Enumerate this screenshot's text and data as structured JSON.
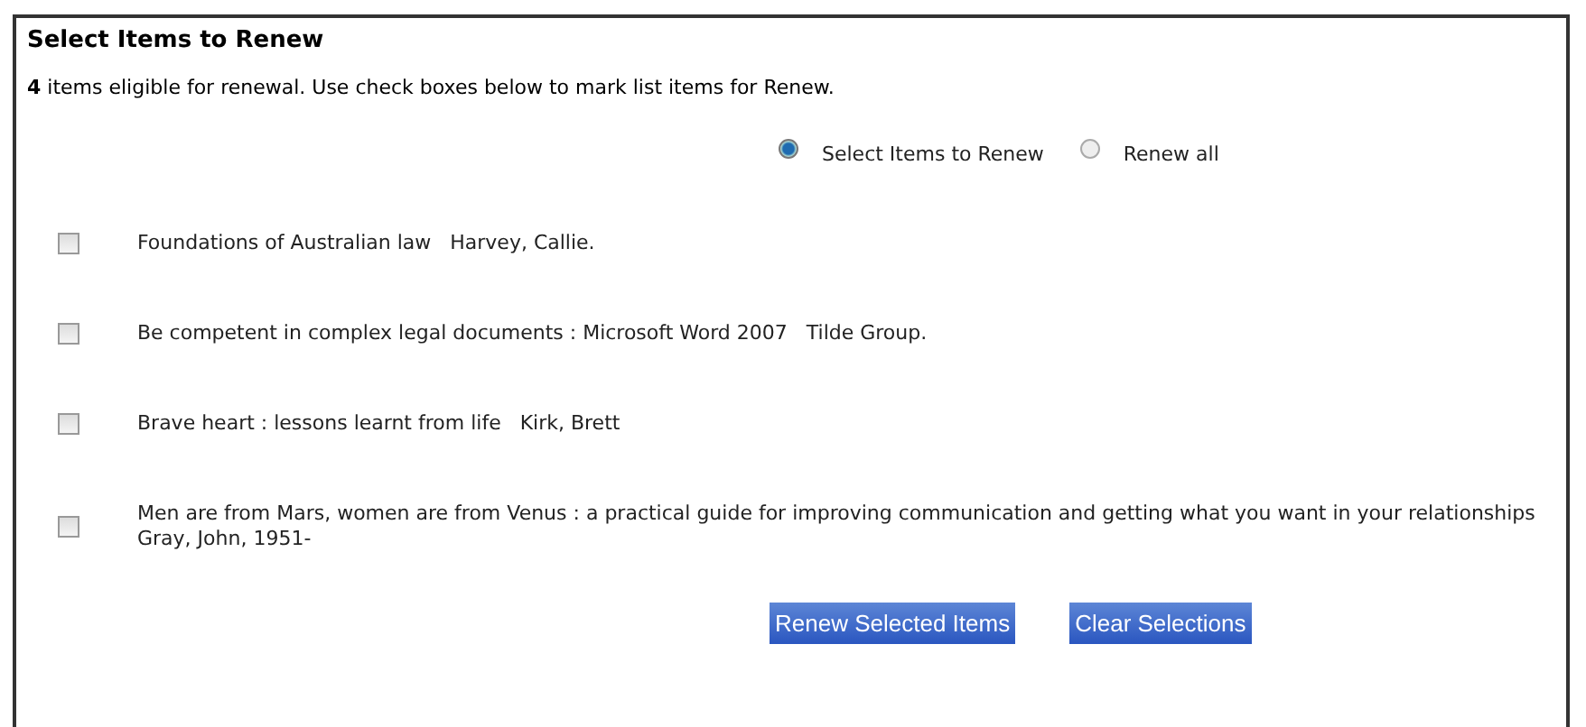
{
  "title": "Select Items to Renew",
  "intro": "**4** items eligible for renewal. Use check boxes below to mark list items for Renew.",
  "modes": [
    {
      "label": "Select Items to Renew",
      "selected": true
    },
    {
      "label": "Renew all",
      "selected": false
    }
  ],
  "items": [
    {
      "text": "Foundations of Australian law   Harvey, Callie.",
      "checked": false
    },
    {
      "text": "Be competent in complex legal documents : Microsoft Word 2007   Tilde Group.",
      "checked": false
    },
    {
      "text": "Brave heart : lessons learnt from life   Kirk, Brett",
      "checked": false
    },
    {
      "text": "Men are from Mars, women are from Venus : a practical guide for improving communication and getting what you want in your relationships   Gray, John, 1951-",
      "checked": false
    }
  ],
  "buttons": [
    "Renew Selected Items",
    "Clear Selections"
  ]
}
